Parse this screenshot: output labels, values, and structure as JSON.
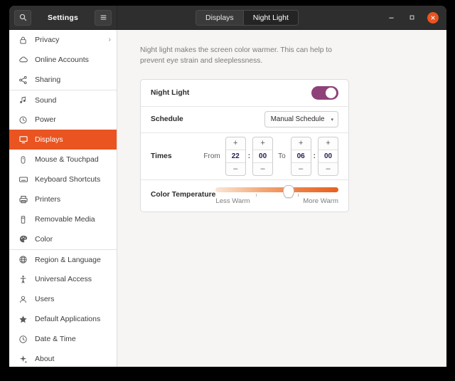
{
  "window": {
    "title": "Settings",
    "search_icon": "search-icon",
    "menu_icon": "hamburger-menu-icon",
    "minimize_label": "–",
    "maximize_label": "▣",
    "close_label": "✕",
    "accent_color": "#e95420",
    "titlebar_color": "#303030"
  },
  "tabs": [
    {
      "label": "Displays",
      "active": false
    },
    {
      "label": "Night Light",
      "active": true
    }
  ],
  "sidebar": {
    "items": [
      {
        "label": "Privacy",
        "icon": "lock-icon",
        "selected": false,
        "chevron": "›",
        "separator": false
      },
      {
        "label": "Online Accounts",
        "icon": "cloud-icon",
        "selected": false,
        "separator": false
      },
      {
        "label": "Sharing",
        "icon": "share-icon",
        "selected": false,
        "separator": false
      },
      {
        "label": "Sound",
        "icon": "music-note-icon",
        "selected": false,
        "separator": true
      },
      {
        "label": "Power",
        "icon": "power-icon",
        "selected": false,
        "separator": false
      },
      {
        "label": "Displays",
        "icon": "display-icon",
        "selected": true,
        "separator": false
      },
      {
        "label": "Mouse & Touchpad",
        "icon": "mouse-icon",
        "selected": false,
        "separator": false
      },
      {
        "label": "Keyboard Shortcuts",
        "icon": "keyboard-icon",
        "selected": false,
        "separator": false
      },
      {
        "label": "Printers",
        "icon": "printer-icon",
        "selected": false,
        "separator": false
      },
      {
        "label": "Removable Media",
        "icon": "removable-media-icon",
        "selected": false,
        "separator": false
      },
      {
        "label": "Color",
        "icon": "color-icon",
        "selected": false,
        "separator": false
      },
      {
        "label": "Region & Language",
        "icon": "globe-icon",
        "selected": false,
        "separator": true
      },
      {
        "label": "Universal Access",
        "icon": "accessibility-icon",
        "selected": false,
        "separator": false
      },
      {
        "label": "Users",
        "icon": "user-icon",
        "selected": false,
        "separator": false
      },
      {
        "label": "Default Applications",
        "icon": "star-icon",
        "selected": false,
        "separator": false
      },
      {
        "label": "Date & Time",
        "icon": "clock-icon",
        "selected": false,
        "separator": false
      },
      {
        "label": "About",
        "icon": "info-sparkle-icon",
        "selected": false,
        "separator": false
      }
    ]
  },
  "main": {
    "intro": "Night light makes the screen color warmer. This can help to prevent eye strain and sleeplessness.",
    "night_light": {
      "label": "Night Light",
      "enabled": true,
      "toggle_color": "#8e4279"
    },
    "schedule": {
      "label": "Schedule",
      "value": "Manual Schedule",
      "caret": "▾"
    },
    "times": {
      "label": "Times",
      "from_label": "From",
      "to_label": "To",
      "from_hour": "22",
      "from_minute": "00",
      "to_hour": "06",
      "to_minute": "00",
      "colon": ":",
      "increment": "+",
      "decrement": "–"
    },
    "color_temperature": {
      "label": "Color Temperature",
      "min_label": "Less Warm",
      "max_label": "More Warm",
      "value_percent": 59
    }
  }
}
